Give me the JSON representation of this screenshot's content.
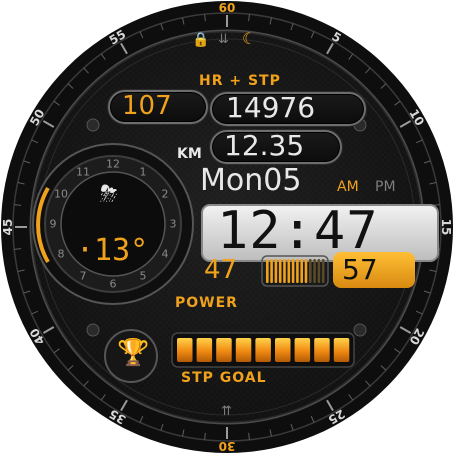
{
  "bezel": {
    "minute_labels": [
      "60",
      "5",
      "10",
      "15",
      "20",
      "25",
      "30",
      "35",
      "40",
      "45",
      "50",
      "55"
    ]
  },
  "status_icons": [
    "lock-icon",
    "double-chevron-down-icon",
    "moon-icon"
  ],
  "header": {
    "label": "HR + STP"
  },
  "heart_rate": {
    "value": "107"
  },
  "steps": {
    "value": "14976"
  },
  "distance": {
    "unit": "KM",
    "value": "12.35"
  },
  "weather": {
    "icon": "thunderstorm-cloud-icon",
    "temperature": "·13°",
    "dial_numbers": [
      "12",
      "1",
      "2",
      "3",
      "4",
      "5",
      "6",
      "7",
      "8",
      "9",
      "10",
      "11"
    ]
  },
  "date": {
    "text": "Mon05",
    "am": "AM",
    "pm": "PM",
    "active": "AM"
  },
  "time": {
    "text": "12:47"
  },
  "power": {
    "label": "POWER",
    "left_value": "47",
    "right_value": "57"
  },
  "step_goal": {
    "label": "STP GOAL",
    "icon": "trophy-icon",
    "segments_total": 9,
    "segments_filled": 9
  },
  "bottom_icon": "double-chevron-up-icon",
  "colors": {
    "accent": "#f0a21c",
    "text": "#e8e8e8",
    "dim": "#7d7d7d",
    "background": "#121212"
  }
}
